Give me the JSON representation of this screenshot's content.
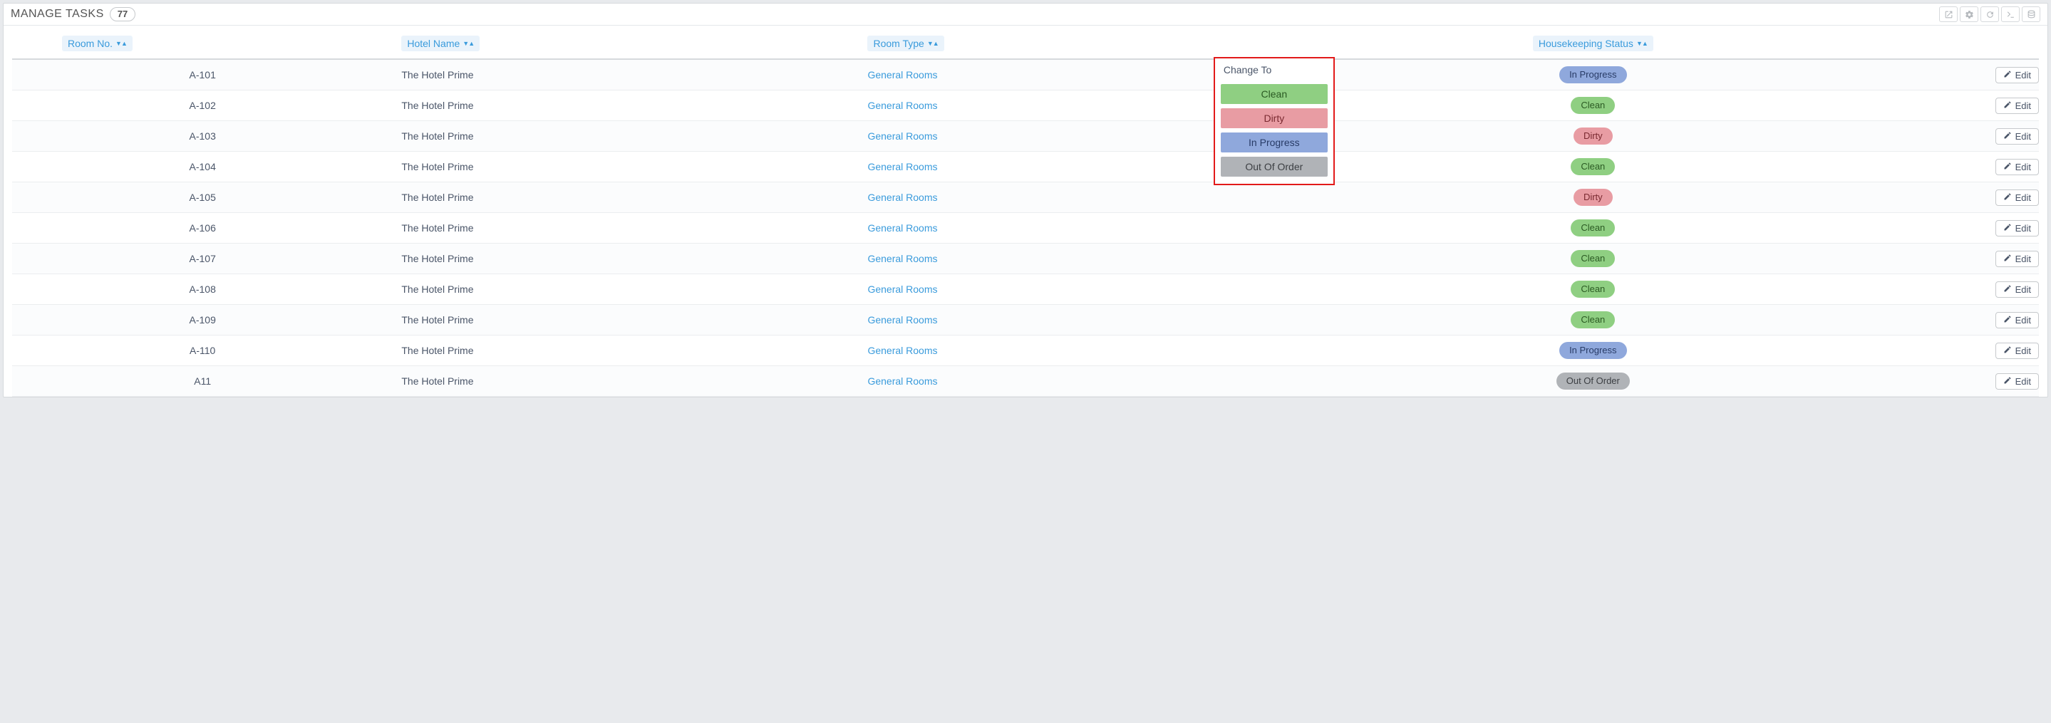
{
  "header": {
    "title": "MANAGE TASKS",
    "count": "77"
  },
  "columns": {
    "room_no": "Room No.",
    "hotel": "Hotel Name",
    "room_type": "Room Type",
    "status": "Housekeeping Status"
  },
  "edit_label": "Edit",
  "popup": {
    "title": "Change To",
    "options": [
      "Clean",
      "Dirty",
      "In Progress",
      "Out Of Order"
    ]
  },
  "rows": [
    {
      "room": "A-101",
      "hotel": "The Hotel Prime",
      "type": "General Rooms",
      "status": "In Progress"
    },
    {
      "room": "A-102",
      "hotel": "The Hotel Prime",
      "type": "General Rooms",
      "status": "Clean"
    },
    {
      "room": "A-103",
      "hotel": "The Hotel Prime",
      "type": "General Rooms",
      "status": "Dirty"
    },
    {
      "room": "A-104",
      "hotel": "The Hotel Prime",
      "type": "General Rooms",
      "status": "Clean"
    },
    {
      "room": "A-105",
      "hotel": "The Hotel Prime",
      "type": "General Rooms",
      "status": "Dirty"
    },
    {
      "room": "A-106",
      "hotel": "The Hotel Prime",
      "type": "General Rooms",
      "status": "Clean"
    },
    {
      "room": "A-107",
      "hotel": "The Hotel Prime",
      "type": "General Rooms",
      "status": "Clean"
    },
    {
      "room": "A-108",
      "hotel": "The Hotel Prime",
      "type": "General Rooms",
      "status": "Clean"
    },
    {
      "room": "A-109",
      "hotel": "The Hotel Prime",
      "type": "General Rooms",
      "status": "Clean"
    },
    {
      "room": "A-110",
      "hotel": "The Hotel Prime",
      "type": "General Rooms",
      "status": "In Progress"
    },
    {
      "room": "A11",
      "hotel": "The Hotel Prime",
      "type": "General Rooms",
      "status": "Out Of Order"
    }
  ]
}
